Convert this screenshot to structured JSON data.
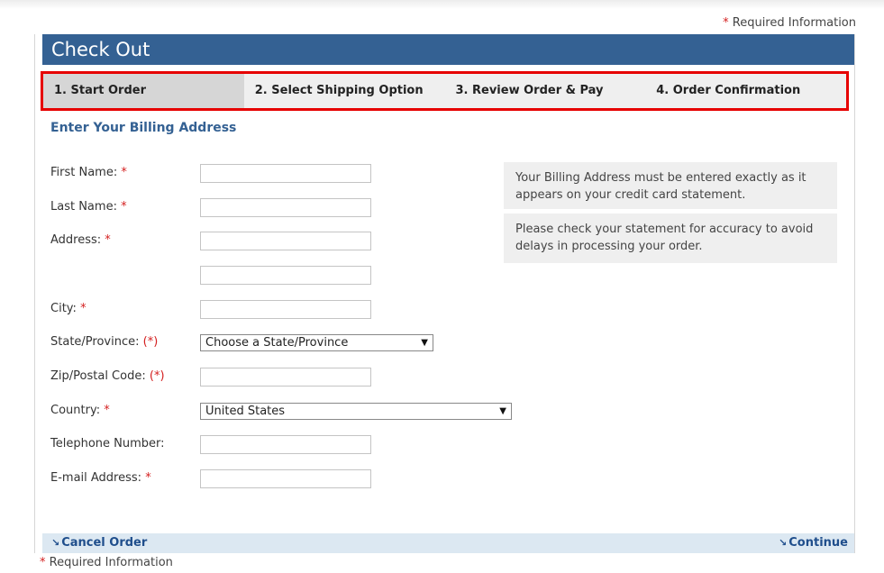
{
  "required_note": {
    "star": "*",
    "text": "Required Information"
  },
  "header": {
    "title": "Check Out"
  },
  "steps": [
    {
      "label": "1. Start Order"
    },
    {
      "label": "2. Select Shipping Option"
    },
    {
      "label": "3. Review Order & Pay"
    },
    {
      "label": "4. Order Confirmation"
    }
  ],
  "form": {
    "section_title": "Enter Your Billing Address",
    "first_name": {
      "label": "First Name:",
      "marker": "*",
      "value": ""
    },
    "last_name": {
      "label": "Last Name:",
      "marker": "*",
      "value": ""
    },
    "address": {
      "label": "Address:",
      "marker": "*",
      "value": "",
      "value2": ""
    },
    "city": {
      "label": "City:",
      "marker": "*",
      "value": ""
    },
    "state": {
      "label": "State/Province:",
      "marker": "(*)",
      "selected": "Choose a State/Province"
    },
    "zip": {
      "label": "Zip/Postal Code:",
      "marker": "(*)",
      "value": ""
    },
    "country": {
      "label": "Country:",
      "marker": "*",
      "selected": "United States"
    },
    "phone": {
      "label": "Telephone Number:",
      "value": ""
    },
    "email": {
      "label": "E-mail Address:",
      "marker": "*",
      "value": ""
    }
  },
  "info": {
    "note1": "Your Billing Address must be entered exactly as it appears on your credit card statement.",
    "note2": "Please check your statement for accuracy to avoid delays in processing your order."
  },
  "footer": {
    "cancel_icon": "↘",
    "cancel_label": "Cancel Order",
    "continue_icon": "↘",
    "continue_label": "Continue"
  },
  "colors": {
    "accent": "#346193",
    "required": "#d42020",
    "highlight": "#e60000"
  }
}
